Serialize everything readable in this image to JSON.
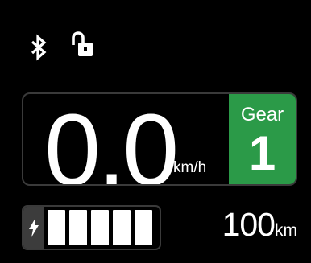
{
  "status": {
    "icons": [
      "bluetooth-icon",
      "unlocked-padlock-icon"
    ]
  },
  "speed": {
    "value": "0.0",
    "unit": "km/h"
  },
  "gear": {
    "label": "Gear",
    "value": "1",
    "color": "#2b9a48"
  },
  "battery": {
    "level_fraction": 1.0,
    "cells_filled": 5,
    "cells_total": 5,
    "icon": "charging-bolt-icon"
  },
  "range": {
    "value": "100",
    "unit": "km"
  }
}
